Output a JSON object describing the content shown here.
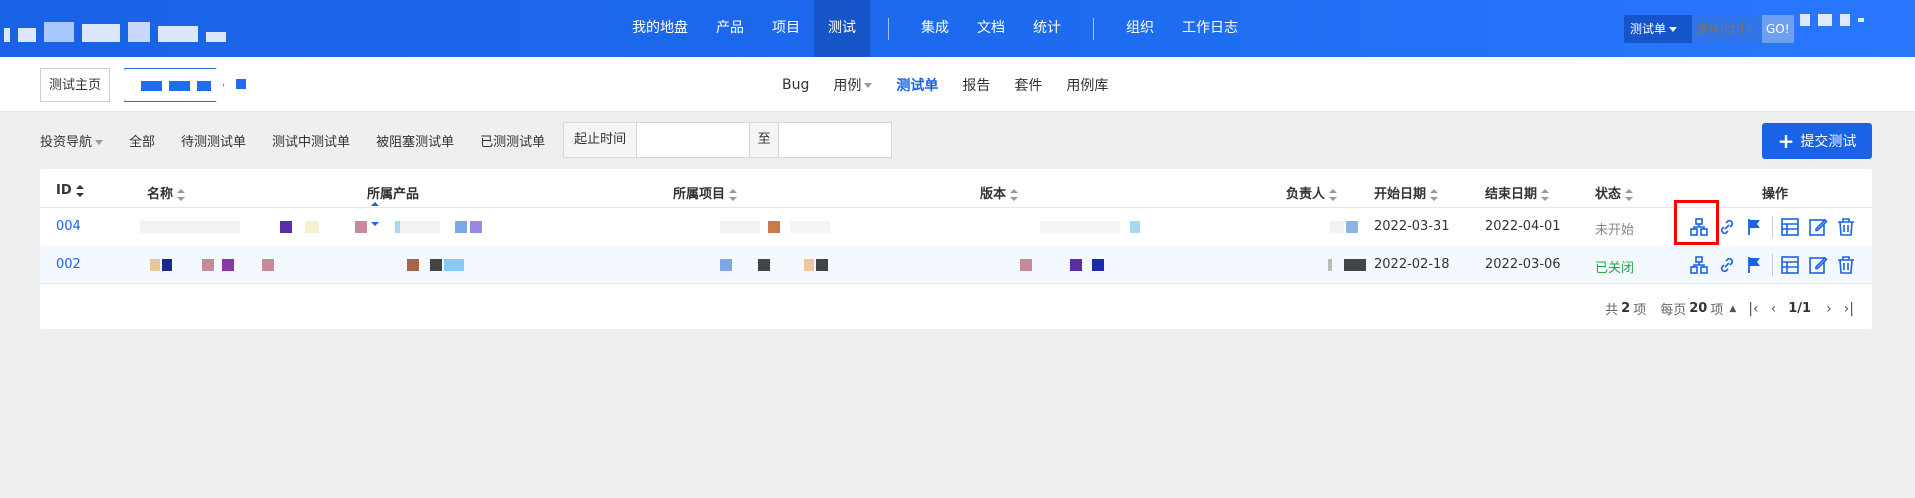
{
  "nav": {
    "items": [
      "我的地盘",
      "产品",
      "项目",
      "测试",
      "集成",
      "文档",
      "统计",
      "组织",
      "工作日志"
    ],
    "active": "测试"
  },
  "search": {
    "type_label": "测试单",
    "placeholder": "编号(ctrl+",
    "go_label": "GO!"
  },
  "breadcrumb": {
    "home": "测试主页"
  },
  "subnav": {
    "items": [
      "Bug",
      "用例",
      "测试单",
      "报告",
      "套件",
      "用例库"
    ],
    "active": "测试单"
  },
  "filters": {
    "nav_label": "投资导航",
    "tabs": [
      "全部",
      "待测测试单",
      "测试中测试单",
      "被阻塞测试单",
      "已测测试单"
    ],
    "date_label": "起止时间",
    "date_sep": "至"
  },
  "submit_label": "提交测试",
  "table": {
    "headers": {
      "id": "ID",
      "name": "名称",
      "product": "所属产品",
      "project": "所属项目",
      "build": "版本",
      "owner": "负责人",
      "begin": "开始日期",
      "end": "结束日期",
      "status": "状态",
      "actions": "操作"
    },
    "rows": [
      {
        "id": "004",
        "begin": "2022-03-31",
        "end": "2022-04-01",
        "status": "未开始"
      },
      {
        "id": "002",
        "begin": "2022-02-18",
        "end": "2022-03-06",
        "status": "已关闭"
      }
    ]
  },
  "pager": {
    "total_prefix": "共",
    "total": "2",
    "total_suffix": "项",
    "per_prefix": "每页",
    "per": "20",
    "per_suffix": "项",
    "page": "1/1"
  },
  "colors": {
    "primary": "#1a62e6",
    "highlight": "#ff0000",
    "status_closed": "#21a64a"
  }
}
